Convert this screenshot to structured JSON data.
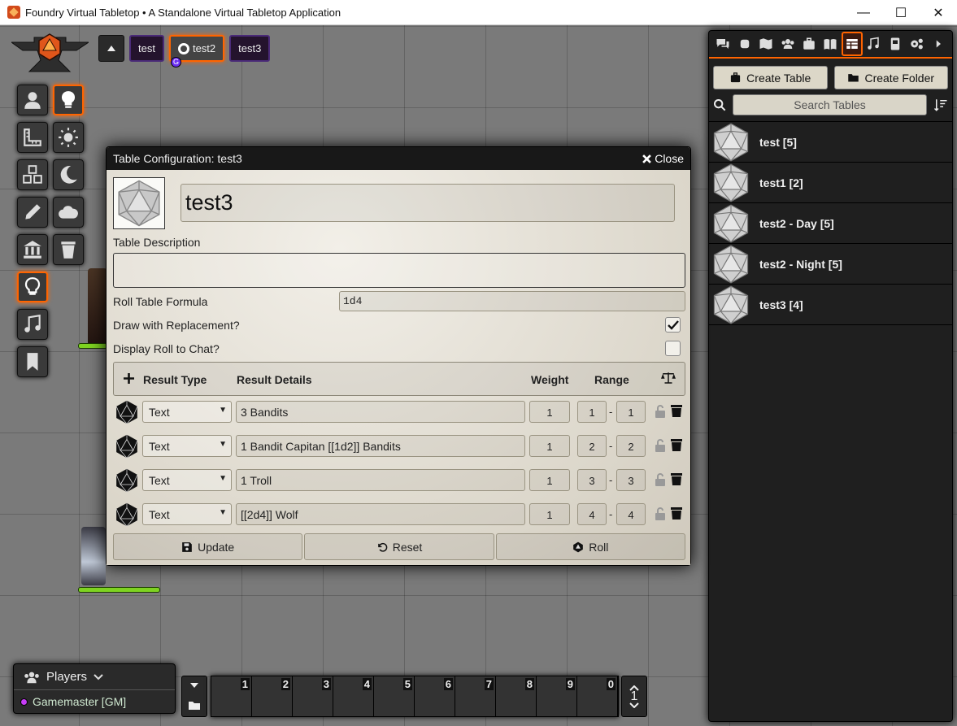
{
  "window": {
    "title": "Foundry Virtual Tabletop • A Standalone Virtual Tabletop Application",
    "minimize": "—",
    "maximize": "☐",
    "close": "✕"
  },
  "scene_nav": {
    "toggle_icon": "caret-up-icon",
    "tabs": [
      {
        "label": "test",
        "active": false
      },
      {
        "label": "test2",
        "active": true,
        "gm_badge": "G"
      },
      {
        "label": "test3",
        "active": false
      }
    ]
  },
  "controls": {
    "primary": [
      "token-icon",
      "lightbulb-icon",
      "ruler-icon",
      "sun-icon",
      "cubes-icon",
      "moon-icon",
      "pencil-icon",
      "cloud-icon",
      "landmark-icon",
      "trash-icon"
    ],
    "secondary": [
      "lightbulb-icon",
      "music-icon",
      "bookmark-icon"
    ]
  },
  "sidebar": {
    "tabs": [
      "comments-icon",
      "fist-icon",
      "map-icon",
      "users-icon",
      "suitcase-icon",
      "book-icon",
      "table-icon",
      "music-icon",
      "journal-icon",
      "cogs-icon",
      "collapse-icon"
    ],
    "active_tab": "table-icon",
    "create_table": "Create Table",
    "create_folder": "Create Folder",
    "search_placeholder": "Search Tables",
    "entries": [
      {
        "name": "test [5]"
      },
      {
        "name": "test1 [2]"
      },
      {
        "name": "test2 - Day [5]"
      },
      {
        "name": "test2 - Night [5]"
      },
      {
        "name": "test3 [4]"
      }
    ]
  },
  "dialog": {
    "title": "Table Configuration: test3",
    "close_label": "Close",
    "name": "test3",
    "description_label": "Table Description",
    "description_value": "",
    "formula_label": "Roll Table Formula",
    "formula_value": "1d4",
    "replacement_label": "Draw with Replacement?",
    "replacement_checked": true,
    "display_roll_label": "Display Roll to Chat?",
    "display_roll_checked": false,
    "headers": {
      "result_type": "Result Type",
      "result_details": "Result Details",
      "weight": "Weight",
      "range": "Range"
    },
    "results": [
      {
        "type": "Text",
        "details": "3 Bandits",
        "weight": "1",
        "low": "1",
        "high": "1"
      },
      {
        "type": "Text",
        "details": "1 Bandit Capitan [[1d2]] Bandits",
        "weight": "1",
        "low": "2",
        "high": "2"
      },
      {
        "type": "Text",
        "details": "1 Troll",
        "weight": "1",
        "low": "3",
        "high": "3"
      },
      {
        "type": "Text",
        "details": "[[2d4]] Wolf",
        "weight": "1",
        "low": "4",
        "high": "4"
      }
    ],
    "range_sep": "-",
    "update_label": "Update",
    "reset_label": "Reset",
    "roll_label": "Roll"
  },
  "players": {
    "header": "Players",
    "list": [
      {
        "name": "Gamemaster [GM]",
        "color": "#c73cf7"
      }
    ]
  },
  "hotbar": {
    "slots": [
      "1",
      "2",
      "3",
      "4",
      "5",
      "6",
      "7",
      "8",
      "9",
      "0"
    ],
    "page": "1"
  },
  "colors": {
    "accent": "#ff6400",
    "token_bar": "#7ed321"
  }
}
